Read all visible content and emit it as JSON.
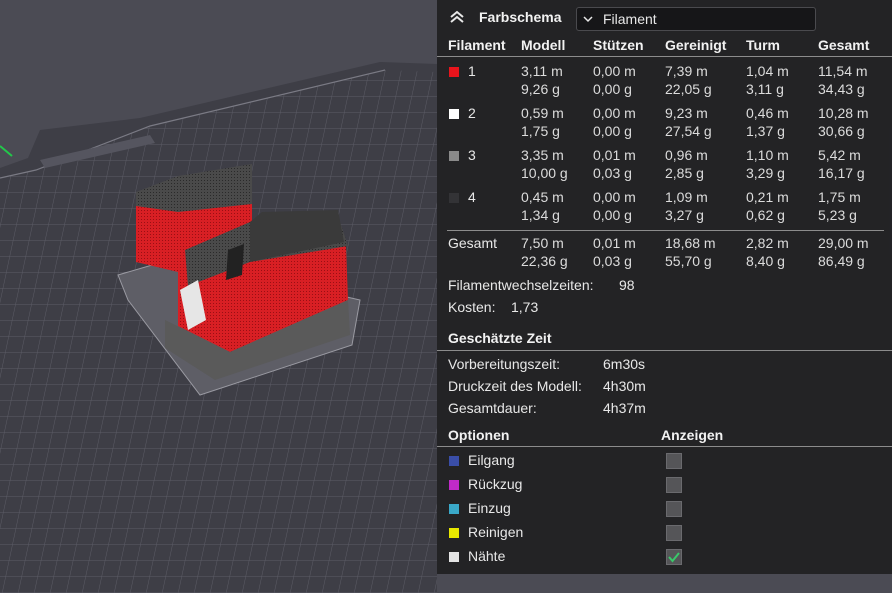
{
  "panel": {
    "title": "Farbschema",
    "scheme_value": "Filament",
    "columns": [
      "Filament",
      "Modell",
      "Stützen",
      "Gereinigt",
      "Turm",
      "Gesamt"
    ],
    "rows": [
      {
        "id": "1",
        "color": "#e8141c",
        "values": [
          [
            "3,11 m",
            "9,26 g"
          ],
          [
            "0,00 m",
            "0,00 g"
          ],
          [
            "7,39 m",
            "22,05 g"
          ],
          [
            "1,04 m",
            "3,11 g"
          ],
          [
            "11,54 m",
            "34,43 g"
          ]
        ]
      },
      {
        "id": "2",
        "color": "#ffffff",
        "values": [
          [
            "0,59 m",
            "1,75 g"
          ],
          [
            "0,00 m",
            "0,00 g"
          ],
          [
            "9,23 m",
            "27,54 g"
          ],
          [
            "0,46 m",
            "1,37 g"
          ],
          [
            "10,28 m",
            "30,66 g"
          ]
        ]
      },
      {
        "id": "3",
        "color": "#8a8a8a",
        "values": [
          [
            "3,35 m",
            "10,00 g"
          ],
          [
            "0,01 m",
            "0,03 g"
          ],
          [
            "0,96 m",
            "2,85 g"
          ],
          [
            "1,10 m",
            "3,29 g"
          ],
          [
            "5,42 m",
            "16,17 g"
          ]
        ]
      },
      {
        "id": "4",
        "color": "#333336",
        "values": [
          [
            "0,45 m",
            "1,34 g"
          ],
          [
            "0,00 m",
            "0,00 g"
          ],
          [
            "1,09 m",
            "3,27 g"
          ],
          [
            "0,21 m",
            "0,62 g"
          ],
          [
            "1,75 m",
            "5,23 g"
          ]
        ]
      }
    ],
    "total": {
      "label": "Gesamt",
      "values": [
        [
          "7,50 m",
          "22,36 g"
        ],
        [
          "0,01 m",
          "0,03 g"
        ],
        [
          "18,68 m",
          "55,70 g"
        ],
        [
          "2,82 m",
          "8,40 g"
        ],
        [
          "29,00 m",
          "86,49 g"
        ]
      ]
    },
    "filament_changes_label": "Filamentwechselzeiten:",
    "filament_changes_value": "98",
    "cost_label": "Kosten:",
    "cost_value": "1,73",
    "time_title": "Geschätzte Zeit",
    "times": [
      {
        "label": "Vorbereitungszeit:",
        "value": "6m30s"
      },
      {
        "label": "Druckzeit des Modell:",
        "value": "4h30m"
      },
      {
        "label": "Gesamtdauer:",
        "value": "4h37m"
      }
    ],
    "options_title": "Optionen",
    "show_title": "Anzeigen",
    "options": [
      {
        "label": "Eilgang",
        "color": "#3a4ea8",
        "checked": false
      },
      {
        "label": "Rückzug",
        "color": "#c02ac8",
        "checked": false
      },
      {
        "label": "Einzug",
        "color": "#3aa8c8",
        "checked": false
      },
      {
        "label": "Reinigen",
        "color": "#e8e800",
        "checked": false
      },
      {
        "label": "Nähte",
        "color": "#e4e4e4",
        "checked": true
      }
    ],
    "icons": {
      "collapse": "chevron-double-up-icon",
      "dropdown": "chevron-down-icon",
      "check": "check-icon"
    }
  }
}
